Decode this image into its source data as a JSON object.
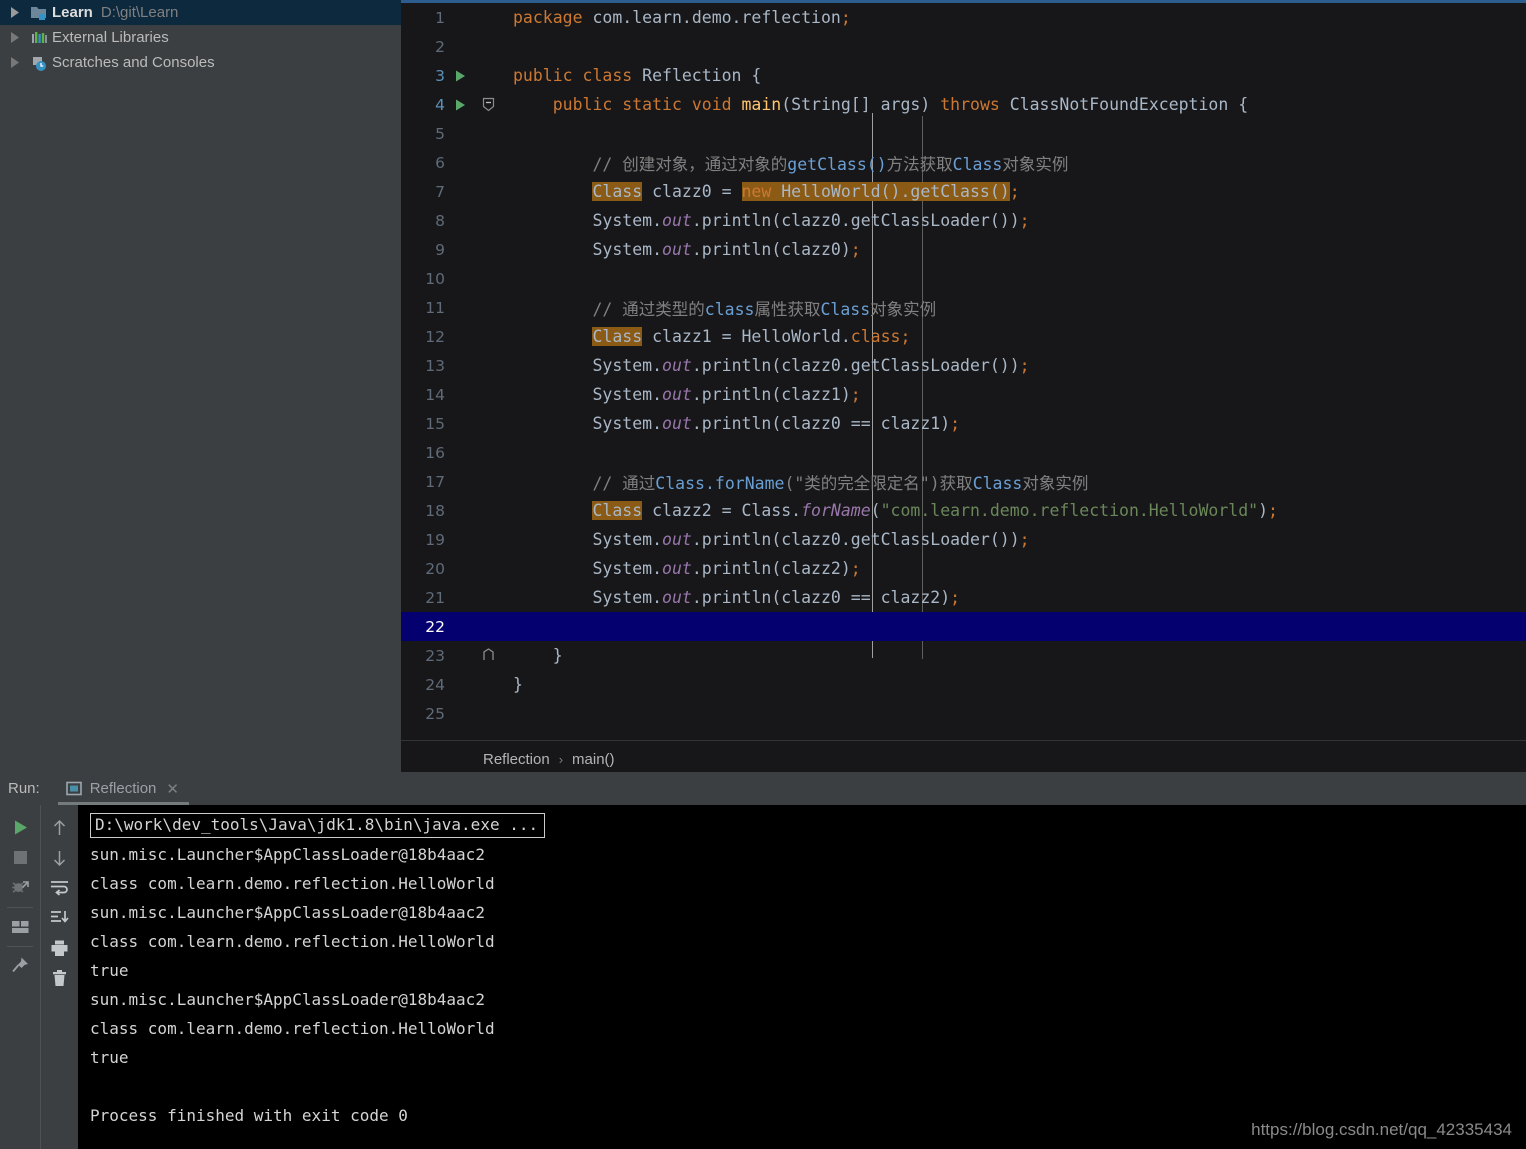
{
  "project_tree": {
    "items": [
      {
        "label": "Learn",
        "sub": "D:\\git\\Learn",
        "icon": "module-folder-icon",
        "selected": true,
        "bold": true
      },
      {
        "label": "External Libraries",
        "sub": "",
        "icon": "libraries-icon",
        "selected": false,
        "bold": false
      },
      {
        "label": "Scratches and Consoles",
        "sub": "",
        "icon": "scratches-icon",
        "selected": false,
        "bold": false
      }
    ]
  },
  "editor": {
    "lines": [
      {
        "n": "1",
        "marker": "",
        "fold": "",
        "html": "<span class='kw'>package</span> <span class='txt'>com.learn.demo.reflection</span><span class='kw'>;</span>",
        "active": false
      },
      {
        "n": "2",
        "marker": "",
        "fold": "",
        "html": "",
        "active": false
      },
      {
        "n": "3",
        "marker": "run",
        "fold": "",
        "html": "<span class='kw'>public class </span><span class='txt'>Reflection {</span>",
        "active": true
      },
      {
        "n": "4",
        "marker": "run",
        "fold": "collapse",
        "html": "    <span class='kw'>public static void </span><span class='mth'>main</span><span class='txt'>(String[] args) </span><span class='kw'>throws </span><span class='txt'>ClassNotFoundException {</span>",
        "active": true
      },
      {
        "n": "5",
        "marker": "",
        "fold": "",
        "html": "",
        "active": false
      },
      {
        "n": "6",
        "marker": "",
        "fold": "",
        "html": "        <span class='cmt'>// 创建对象，通过对象的</span><span class='cmt-hl'>getClass()</span><span class='cmt'>方法获取</span><span class='cmt-hl'>Class</span><span class='cmt'>对象实例</span>",
        "active": false
      },
      {
        "n": "7",
        "marker": "",
        "fold": "",
        "html": "        <span class='hl-box'>Class</span><span class='txt'> clazz0 = </span><span class='hl-box'><span class='kw'>new </span>HelloWorld().getClass()</span><span class='kw'>;</span>",
        "active": false
      },
      {
        "n": "8",
        "marker": "",
        "fold": "",
        "html": "        <span class='txt'>System.</span><span class='fld'>out</span><span class='txt'>.println(clazz0.getClassLoader())</span><span class='kw'>;</span>",
        "active": false
      },
      {
        "n": "9",
        "marker": "",
        "fold": "",
        "html": "        <span class='txt'>System.</span><span class='fld'>out</span><span class='txt'>.println(clazz0)</span><span class='kw'>;</span>",
        "active": false
      },
      {
        "n": "10",
        "marker": "",
        "fold": "",
        "html": "",
        "active": false
      },
      {
        "n": "11",
        "marker": "",
        "fold": "",
        "html": "        <span class='cmt'>// 通过类型的</span><span class='cmt-hl'>class</span><span class='cmt'>属性获取</span><span class='cmt-hl'>Class</span><span class='cmt'>对象实例</span>",
        "active": false
      },
      {
        "n": "12",
        "marker": "",
        "fold": "",
        "html": "        <span class='hl-box'>Class</span><span class='txt'> clazz1 = HelloWorld.</span><span class='kw'>class;</span>",
        "active": false
      },
      {
        "n": "13",
        "marker": "",
        "fold": "",
        "html": "        <span class='txt'>System.</span><span class='fld'>out</span><span class='txt'>.println(clazz0.getClassLoader())</span><span class='kw'>;</span>",
        "active": false
      },
      {
        "n": "14",
        "marker": "",
        "fold": "",
        "html": "        <span class='txt'>System.</span><span class='fld'>out</span><span class='txt'>.println(clazz1)</span><span class='kw'>;</span>",
        "active": false
      },
      {
        "n": "15",
        "marker": "",
        "fold": "",
        "html": "        <span class='txt'>System.</span><span class='fld'>out</span><span class='txt'>.println(clazz0 == clazz1)</span><span class='kw'>;</span>",
        "active": false
      },
      {
        "n": "16",
        "marker": "",
        "fold": "",
        "html": "",
        "active": false
      },
      {
        "n": "17",
        "marker": "",
        "fold": "",
        "html": "        <span class='cmt'>// 通过</span><span class='cmt-hl'>Class.forName</span><span class='cmt'>(\"类的完全限定名\")获取</span><span class='cmt-hl'>Class</span><span class='cmt'>对象实例</span>",
        "active": false
      },
      {
        "n": "18",
        "marker": "",
        "fold": "",
        "html": "        <span class='hl-box'>Class</span><span class='txt'> clazz2 = Class.</span><span class='fld'>forName</span><span class='txt'>(</span><span class='str'>\"com.learn.demo.reflection.HelloWorld\"</span><span class='txt'>)</span><span class='kw'>;</span>",
        "active": false
      },
      {
        "n": "19",
        "marker": "",
        "fold": "",
        "html": "        <span class='txt'>System.</span><span class='fld'>out</span><span class='txt'>.println(clazz0.getClassLoader())</span><span class='kw'>;</span>",
        "active": false
      },
      {
        "n": "20",
        "marker": "",
        "fold": "",
        "html": "        <span class='txt'>System.</span><span class='fld'>out</span><span class='txt'>.println(clazz2)</span><span class='kw'>;</span>",
        "active": false
      },
      {
        "n": "21",
        "marker": "",
        "fold": "",
        "html": "        <span class='txt'>System.</span><span class='fld'>out</span><span class='txt'>.println(clazz0 == clazz2)</span><span class='kw'>;</span>",
        "active": false
      },
      {
        "n": "22",
        "marker": "",
        "fold": "",
        "html": "",
        "active": false,
        "cursor": true
      },
      {
        "n": "23",
        "marker": "",
        "fold": "end",
        "html": "    <span class='txt'>}</span>",
        "active": false
      },
      {
        "n": "24",
        "marker": "",
        "fold": "",
        "html": "<span class='txt'>}</span>",
        "active": false
      },
      {
        "n": "25",
        "marker": "",
        "fold": "",
        "html": "",
        "active": false
      }
    ],
    "breadcrumb": {
      "class_name": "Reflection",
      "separator": "›",
      "method_name": "main()"
    }
  },
  "run_panel": {
    "label": "Run:",
    "tab": {
      "name": "Reflection",
      "close": "✕",
      "icon": "console-tab-icon"
    },
    "toolbar_left": [
      {
        "name": "rerun-button",
        "icon": "play-icon"
      },
      {
        "name": "stop-button",
        "icon": "stop-square-icon"
      },
      {
        "name": "rerun-failed-button",
        "icon": "rerun-bug-icon"
      },
      {
        "name": "layout-settings-button",
        "icon": "layout-icon"
      },
      {
        "name": "pin-tab-button",
        "icon": "pin-icon"
      }
    ],
    "toolbar_right": [
      {
        "name": "up-stacktrace-button",
        "icon": "arrow-up-icon"
      },
      {
        "name": "down-stacktrace-button",
        "icon": "arrow-down-icon"
      },
      {
        "name": "soft-wrap-button",
        "icon": "soft-wrap-icon"
      },
      {
        "name": "scroll-to-end-button",
        "icon": "scroll-to-end-icon"
      },
      {
        "name": "print-button",
        "icon": "printer-icon"
      },
      {
        "name": "clear-all-button",
        "icon": "trash-icon"
      }
    ],
    "console": {
      "command": "D:\\work\\dev_tools\\Java\\jdk1.8\\bin\\java.exe ...",
      "output": [
        "sun.misc.Launcher$AppClassLoader@18b4aac2",
        "class com.learn.demo.reflection.HelloWorld",
        "sun.misc.Launcher$AppClassLoader@18b4aac2",
        "class com.learn.demo.reflection.HelloWorld",
        "true",
        "sun.misc.Launcher$AppClassLoader@18b4aac2",
        "class com.learn.demo.reflection.HelloWorld",
        "true",
        "",
        "Process finished with exit code 0"
      ]
    },
    "watermark": "https://blog.csdn.net/qq_42335434"
  },
  "colors": {
    "panel_bg": "#3c3f41",
    "editor_bg": "#171719",
    "console_bg": "#000000",
    "selection_blue": "#0d293e",
    "cursor_line": "#04006f",
    "keyword_orange": "#cc7832",
    "string_green": "#6a8759",
    "field_purple": "#9876aa",
    "method_yellow": "#ffc66d",
    "comment_gray": "#808080",
    "comment_link": "#6a9fd4",
    "highlight_brown": "#8b5a14",
    "run_green": "#59a869"
  }
}
